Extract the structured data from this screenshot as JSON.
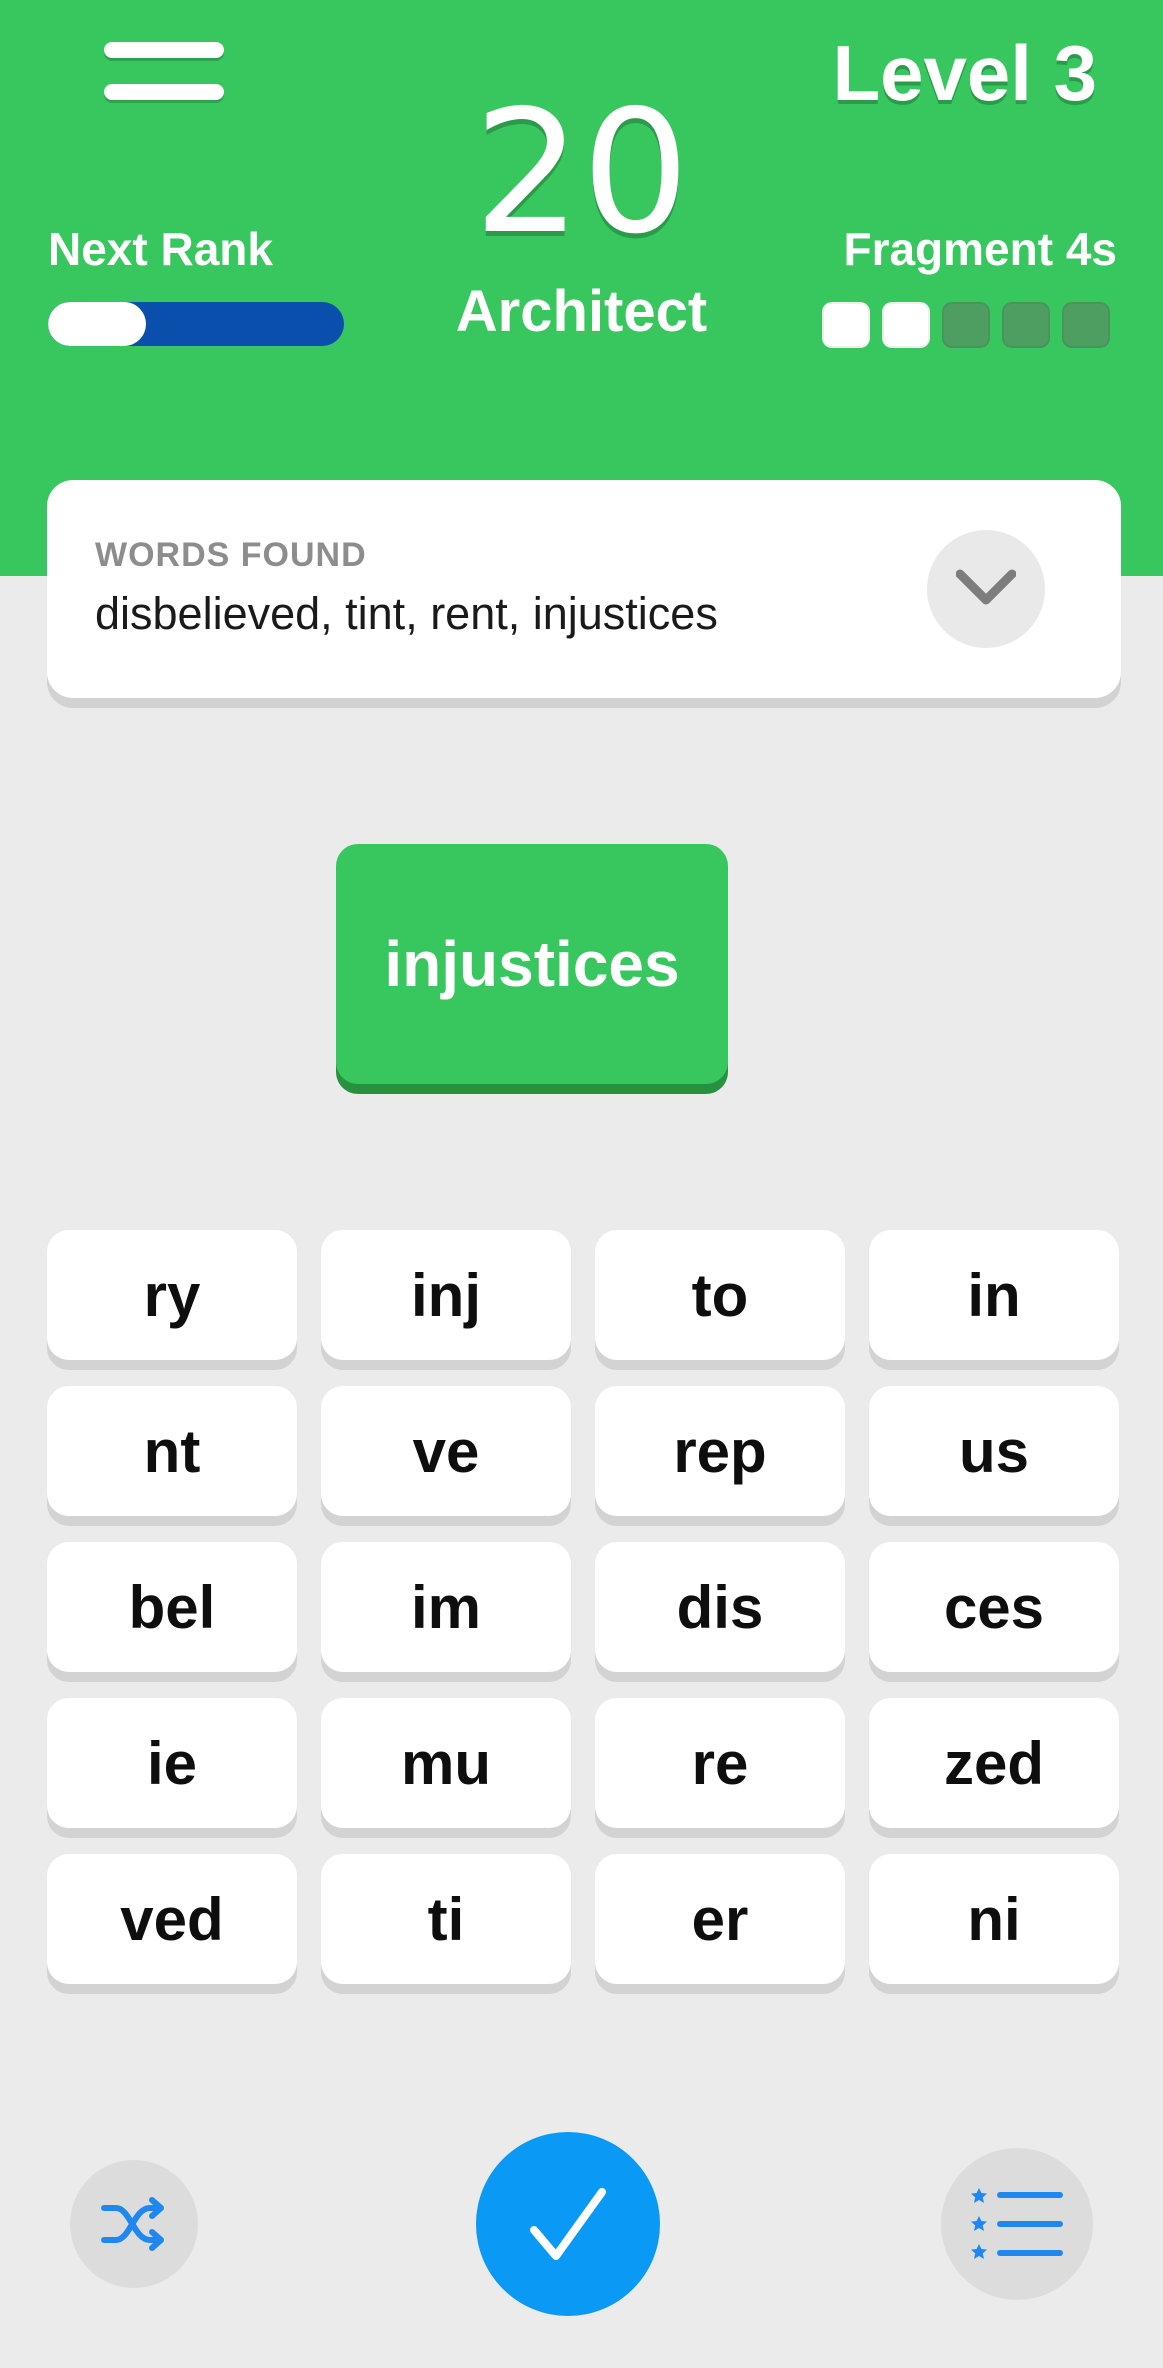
{
  "header": {
    "level_label": "Level 3",
    "score": "20",
    "rank_name": "Architect",
    "next_rank_label": "Next Rank",
    "next_rank_progress": 0.33,
    "fragment_label": "Fragment 4s",
    "fragments_filled": 2,
    "fragments_total": 5,
    "colors": {
      "header_bg": "#38c75f",
      "rank_bar": "#0b4fad",
      "fragment_empty": "#4e9e62"
    }
  },
  "words_found": {
    "title": "WORDS FOUND",
    "list": "disbelieved, tint, rent, injustices",
    "expand_icon": "chevron-down-icon"
  },
  "current_word": "injustices",
  "tiles": [
    "ry",
    "inj",
    "to",
    "in",
    "nt",
    "ve",
    "rep",
    "us",
    "bel",
    "im",
    "dis",
    "ces",
    "ie",
    "mu",
    "re",
    "zed",
    "ved",
    "ti",
    "er",
    "ni"
  ],
  "footer": {
    "shuffle_icon": "shuffle-icon",
    "submit_icon": "checkmark-icon",
    "list_icon": "starred-list-icon",
    "colors": {
      "submit": "#0a9af5",
      "icon_blue": "#1e88f0"
    }
  }
}
